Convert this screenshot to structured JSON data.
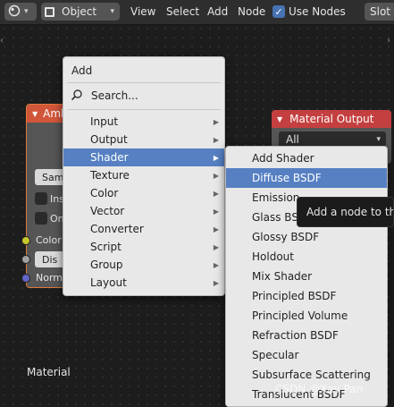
{
  "header": {
    "mode_label": "Object",
    "menu": [
      "View",
      "Select",
      "Add",
      "Node"
    ],
    "use_nodes_label": "Use Nodes",
    "use_nodes_checked": true,
    "slot_label": "Slot"
  },
  "nodes": {
    "ambient": {
      "title": "Amb",
      "buttons": [
        "Sam",
        "Dis"
      ],
      "checks": [
        "Insi",
        "Onl"
      ],
      "sockets": [
        "Color",
        "Normal"
      ]
    },
    "material_output": {
      "title": "Material Output",
      "target": "All"
    }
  },
  "canvas_label": "Material",
  "add_menu": {
    "title": "Add",
    "search": "Search...",
    "items": [
      "Input",
      "Output",
      "Shader",
      "Texture",
      "Color",
      "Vector",
      "Converter",
      "Script",
      "Group",
      "Layout"
    ],
    "underline_index": [
      0,
      0,
      0,
      0,
      0,
      0,
      1,
      1,
      0,
      0
    ],
    "selected": "Shader"
  },
  "shader_menu": {
    "items": [
      "Add Shader",
      "Diffuse BSDF",
      "Emission",
      "Glass BSDF",
      "Glossy BSDF",
      "Holdout",
      "Mix Shader",
      "Principled BSDF",
      "Principled Volume",
      "Refraction BSDF",
      "Specular",
      "Subsurface Scattering",
      "Translucent BSDF"
    ],
    "selected": "Diffuse BSDF"
  },
  "tooltip": "Add a node to the a",
  "watermark": "CSDN @Xav Pan",
  "colors": {
    "accent": "#5680c2",
    "ambient_header": "#d2563a",
    "material_output_header": "#c44040",
    "socket_color": "#c7c729",
    "socket_gray": "#a1a1a1",
    "socket_normal": "#6363c7"
  }
}
